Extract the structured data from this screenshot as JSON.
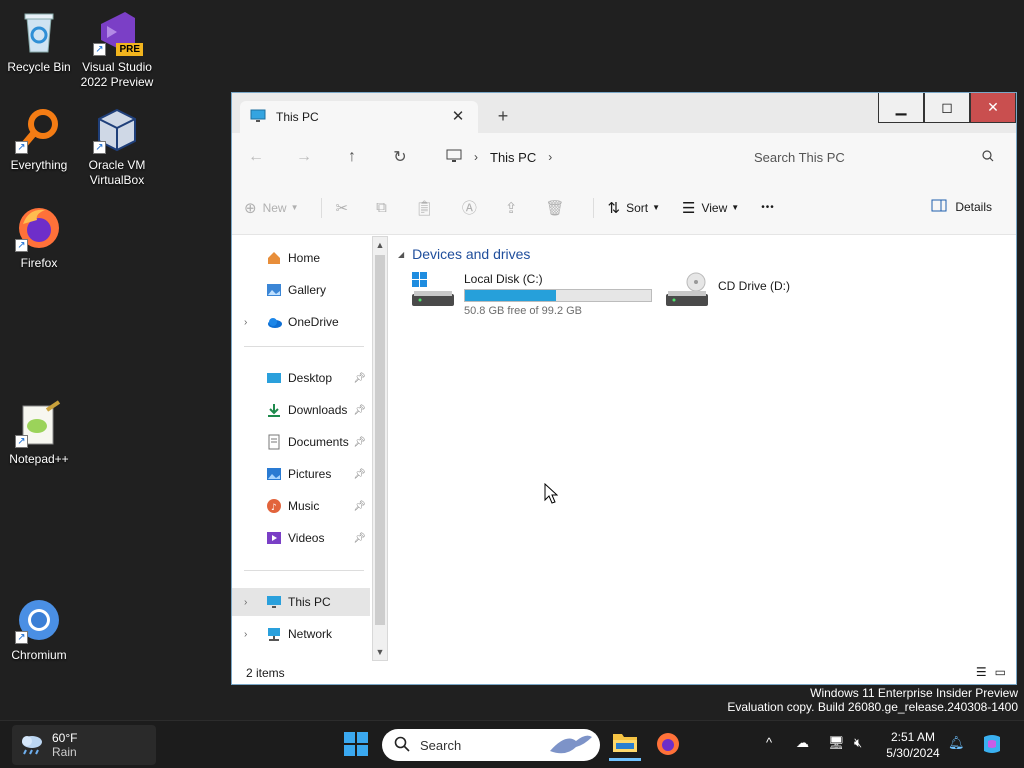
{
  "desktop": {
    "icons": [
      {
        "label": "Recycle Bin"
      },
      {
        "label": "Visual Studio 2022 Preview",
        "badge": "PRE"
      },
      {
        "label": "Everything"
      },
      {
        "label": "Oracle VM VirtualBox"
      },
      {
        "label": "Firefox"
      },
      {
        "label": "Notepad++"
      },
      {
        "label": "Chromium"
      }
    ]
  },
  "window": {
    "tab_title": "This PC",
    "address": {
      "crumb": "This PC"
    },
    "search": {
      "placeholder": "Search This PC"
    },
    "commands": {
      "new": "New",
      "sort": "Sort",
      "view": "View",
      "more": "•••",
      "details": "Details"
    },
    "nav_pane": {
      "items": [
        {
          "label": "Home"
        },
        {
          "label": "Gallery"
        },
        {
          "label": "OneDrive"
        },
        {
          "label": "Desktop"
        },
        {
          "label": "Downloads"
        },
        {
          "label": "Documents"
        },
        {
          "label": "Pictures"
        },
        {
          "label": "Music"
        },
        {
          "label": "Videos"
        },
        {
          "label": "This PC"
        },
        {
          "label": "Network"
        }
      ]
    },
    "content": {
      "group_header": "Devices and drives",
      "drives": [
        {
          "name": "Local Disk (C:)",
          "subtext": "50.8 GB free of 99.2 GB",
          "used_fraction": 0.488
        },
        {
          "name": "CD Drive (D:)"
        }
      ]
    },
    "status": {
      "item_count": "2 items"
    }
  },
  "watermark": {
    "line1": "Windows 11 Enterprise Insider Preview",
    "line2": "Evaluation copy. Build 26080.ge_release.240308-1400"
  },
  "taskbar": {
    "weather": {
      "temp": "60°F",
      "condition": "Rain"
    },
    "search_label": "Search",
    "clock": {
      "time": "2:51 AM",
      "date": "5/30/2024"
    }
  },
  "colors": {
    "accent": "#26a0da",
    "header_blue": "#1f4e9c",
    "close_red": "#c94f4f"
  }
}
